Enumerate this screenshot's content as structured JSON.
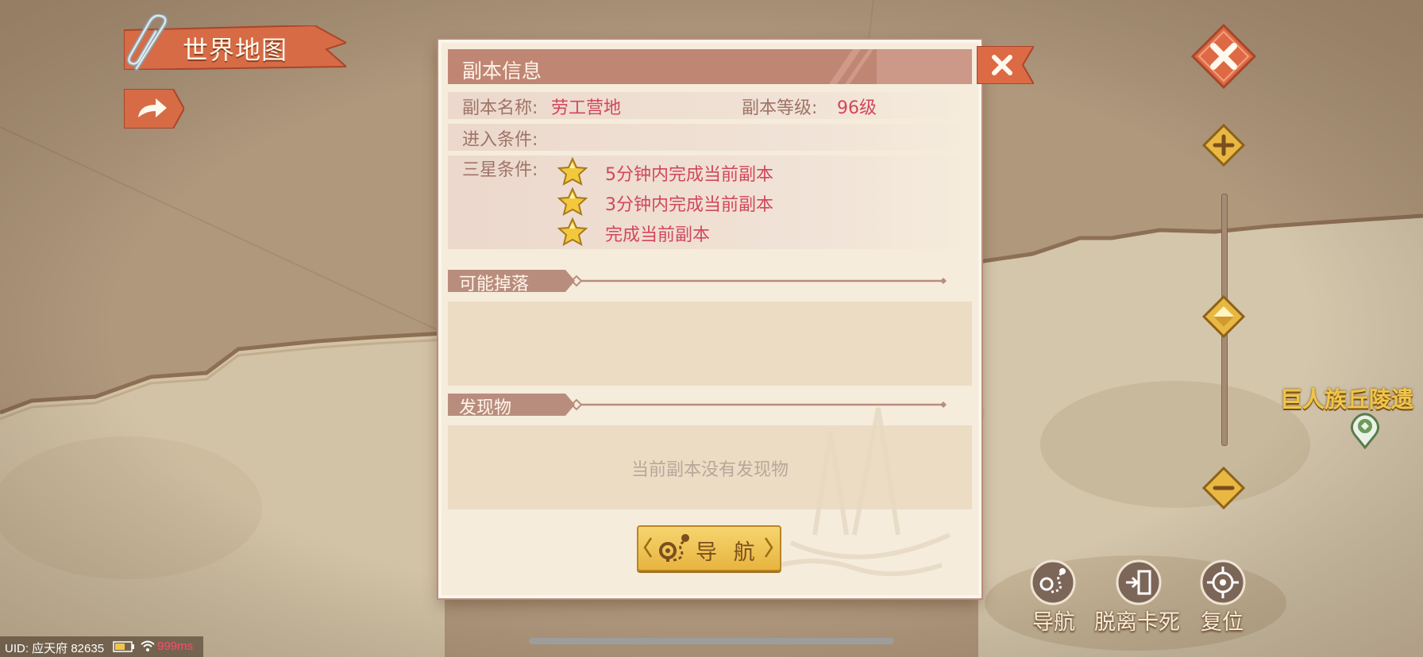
{
  "map": {
    "title": "世界地图",
    "place_label": "巨人族丘陵遗"
  },
  "dialog": {
    "header": "副本信息",
    "name_label": "副本名称:",
    "name_value": "劳工营地",
    "level_label": "副本等级:",
    "level_value": "96级",
    "entry_label": "进入条件:",
    "entry_value": "",
    "stars_label": "三星条件:",
    "star_conditions": [
      "5分钟内完成当前副本",
      "3分钟内完成当前副本",
      "完成当前副本"
    ],
    "drops_label": "可能掉落",
    "finds_label": "发现物",
    "finds_empty": "当前副本没有发现物",
    "navigate_button": "导 航"
  },
  "side": {
    "navigate": "导航",
    "unstuck": "脱离卡死",
    "reset": "复位"
  },
  "status": {
    "uid": "UID: 应天府 82635",
    "ping": "999ms"
  },
  "colors": {
    "accent": "#e0714b",
    "header": "#c08674",
    "highlight": "#d2475a",
    "gold": "#e8b43f"
  }
}
